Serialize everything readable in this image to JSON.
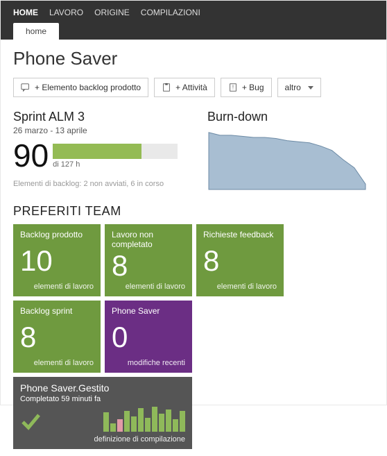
{
  "nav": {
    "items": [
      {
        "label": "HOME",
        "active": true
      },
      {
        "label": "LAVORO",
        "active": false
      },
      {
        "label": "ORIGINE",
        "active": false
      },
      {
        "label": "COMPILAZIONI",
        "active": false
      }
    ],
    "subtab": "home"
  },
  "title": "Phone Saver",
  "toolbar": {
    "add_backlog": "+ Elemento backlog prodotto",
    "add_activity": "+ Attività",
    "add_bug": "+ Bug",
    "other": "altro"
  },
  "sprint": {
    "name": "Sprint ALM 3",
    "dates": "26 marzo - 13 aprile",
    "hours_done": "90",
    "hours_total": "di 127 h",
    "progress_pct": 71,
    "backlog_note": "Elementi di backlog: 2 non avviati, 6 in corso"
  },
  "burndown": {
    "title": "Burn-down"
  },
  "chart_data": {
    "type": "area",
    "title": "Burn-down",
    "x": [
      0,
      1,
      2,
      3,
      4,
      5,
      6,
      7,
      8,
      9,
      10,
      11,
      12,
      13,
      14
    ],
    "values": [
      105,
      100,
      100,
      98,
      96,
      96,
      94,
      90,
      88,
      86,
      80,
      72,
      55,
      40,
      10
    ],
    "ylim": [
      0,
      110
    ],
    "xlabel": "",
    "ylabel": ""
  },
  "favorites_title": "PREFERITI TEAM",
  "tiles": [
    {
      "kind": "green",
      "title": "Backlog prodotto",
      "value": "10",
      "footer": "elementi di lavoro"
    },
    {
      "kind": "green",
      "title": "Lavoro non completato",
      "value": "8",
      "footer": "elementi di lavoro"
    },
    {
      "kind": "green",
      "title": "Richieste feedback",
      "value": "8",
      "footer": "elementi di lavoro"
    },
    {
      "kind": "green",
      "title": "Backlog sprint",
      "value": "8",
      "footer": "elementi di lavoro"
    },
    {
      "kind": "purple",
      "title": "Phone Saver",
      "value": "0",
      "footer": "modifiche recenti"
    },
    {
      "kind": "gray",
      "title": "Phone Saver.Gestito",
      "subtitle": "Completato 59 minuti fa",
      "footer": "definizione di compilazione",
      "bars": [
        28,
        12,
        18,
        30,
        22,
        34,
        20,
        36,
        26,
        32,
        18,
        30
      ],
      "bar_pink_index": 2
    }
  ]
}
